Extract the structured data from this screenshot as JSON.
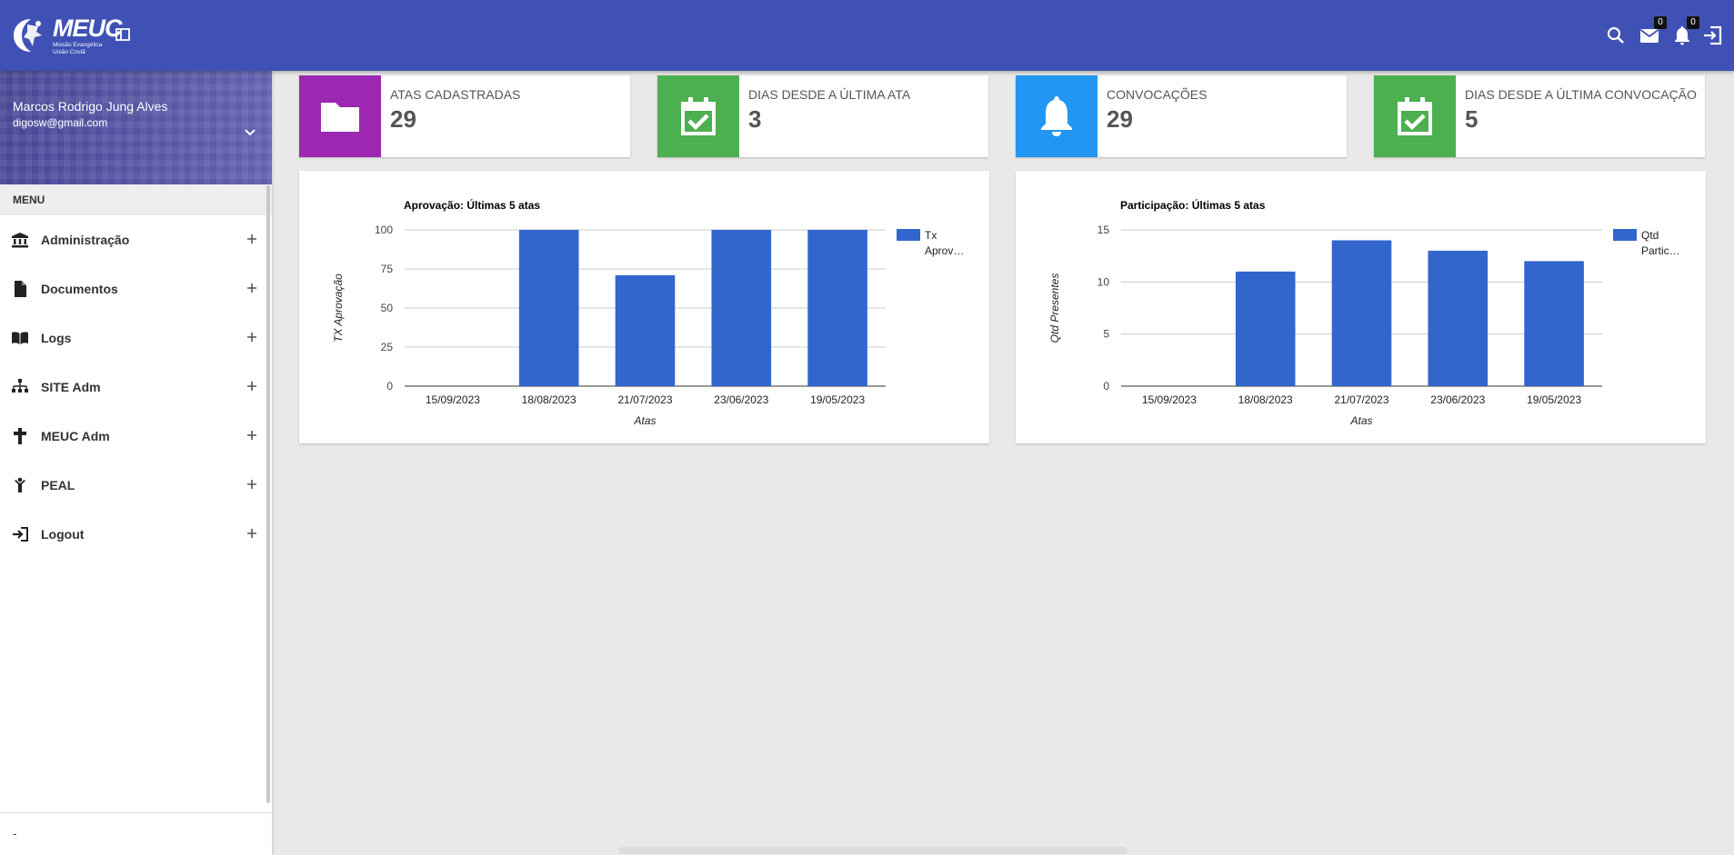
{
  "header": {
    "logo_text": "MEUC",
    "logo_subtitle_1": "Missão Evangélica",
    "logo_subtitle_2": "União Cristã",
    "icons": [
      "meuc-logo-icon",
      "layout-toggle-icon",
      "search-icon",
      "mail-icon",
      "bell-icon",
      "exit-icon"
    ],
    "mail_badge": "0",
    "notification_badge": "0",
    "color": "#3f51b5"
  },
  "sidebar": {
    "user_name": "Marcos Rodrigo Jung Alves",
    "user_email": "digosw@gmail.com",
    "menu_header": "MENU",
    "items": [
      {
        "label": "Administração",
        "icon": "bank-icon"
      },
      {
        "label": "Documentos",
        "icon": "document-icon"
      },
      {
        "label": "Logs",
        "icon": "book-icon"
      },
      {
        "label": "SITE Adm",
        "icon": "sitemap-icon"
      },
      {
        "label": "MEUC Adm",
        "icon": "cross-icon"
      },
      {
        "label": "PEAL",
        "icon": "person-icon"
      },
      {
        "label": "Logout",
        "icon": "login-icon"
      }
    ],
    "footer_text": "-"
  },
  "info_boxes": [
    {
      "title": "ATAS CADASTRADAS",
      "value": "29",
      "color": "#9c27b0",
      "icon": "folder-icon"
    },
    {
      "title": "DIAS DESDE A ÚLTIMA ATA",
      "value": "3",
      "color": "#4caf50",
      "icon": "calendar-check-icon"
    },
    {
      "title": "CONVOCAÇÕES",
      "value": "29",
      "color": "#2196f3",
      "icon": "bell-icon"
    },
    {
      "title": "DIAS DESDE A ÚLTIMA CONVOCAÇÃO",
      "value": "5",
      "color": "#4caf50",
      "icon": "calendar-check-icon"
    }
  ],
  "chart_data": [
    {
      "type": "bar",
      "title": "Aprovação: Últimas 5 atas",
      "xlabel": "Atas",
      "ylabel": "TX Aprovação",
      "categories": [
        "15/09/2023",
        "18/08/2023",
        "21/07/2023",
        "23/06/2023",
        "19/05/2023"
      ],
      "series": [
        {
          "name": "Tx Aprovação",
          "values": [
            0,
            100,
            71,
            100,
            100
          ]
        }
      ],
      "legend_lines": [
        "Tx",
        "Aprov…"
      ],
      "ylim": [
        0,
        100
      ],
      "yticks": [
        "0",
        "25",
        "50",
        "75",
        "100"
      ],
      "color": "#3366cc",
      "grid": true,
      "legend": "right"
    },
    {
      "type": "bar",
      "title": "Participação: Últimas 5 atas",
      "xlabel": "Atas",
      "ylabel": "Qtd Presentes",
      "categories": [
        "15/09/2023",
        "18/08/2023",
        "21/07/2023",
        "23/06/2023",
        "19/05/2023"
      ],
      "series": [
        {
          "name": "Qtd Participantes",
          "values": [
            0,
            11,
            14,
            13,
            12
          ]
        }
      ],
      "legend_lines": [
        "Qtd",
        "Partic…"
      ],
      "ylim": [
        0,
        15
      ],
      "yticks": [
        "0",
        "5",
        "10",
        "15"
      ],
      "color": "#3366cc",
      "grid": true,
      "legend": "right"
    }
  ]
}
